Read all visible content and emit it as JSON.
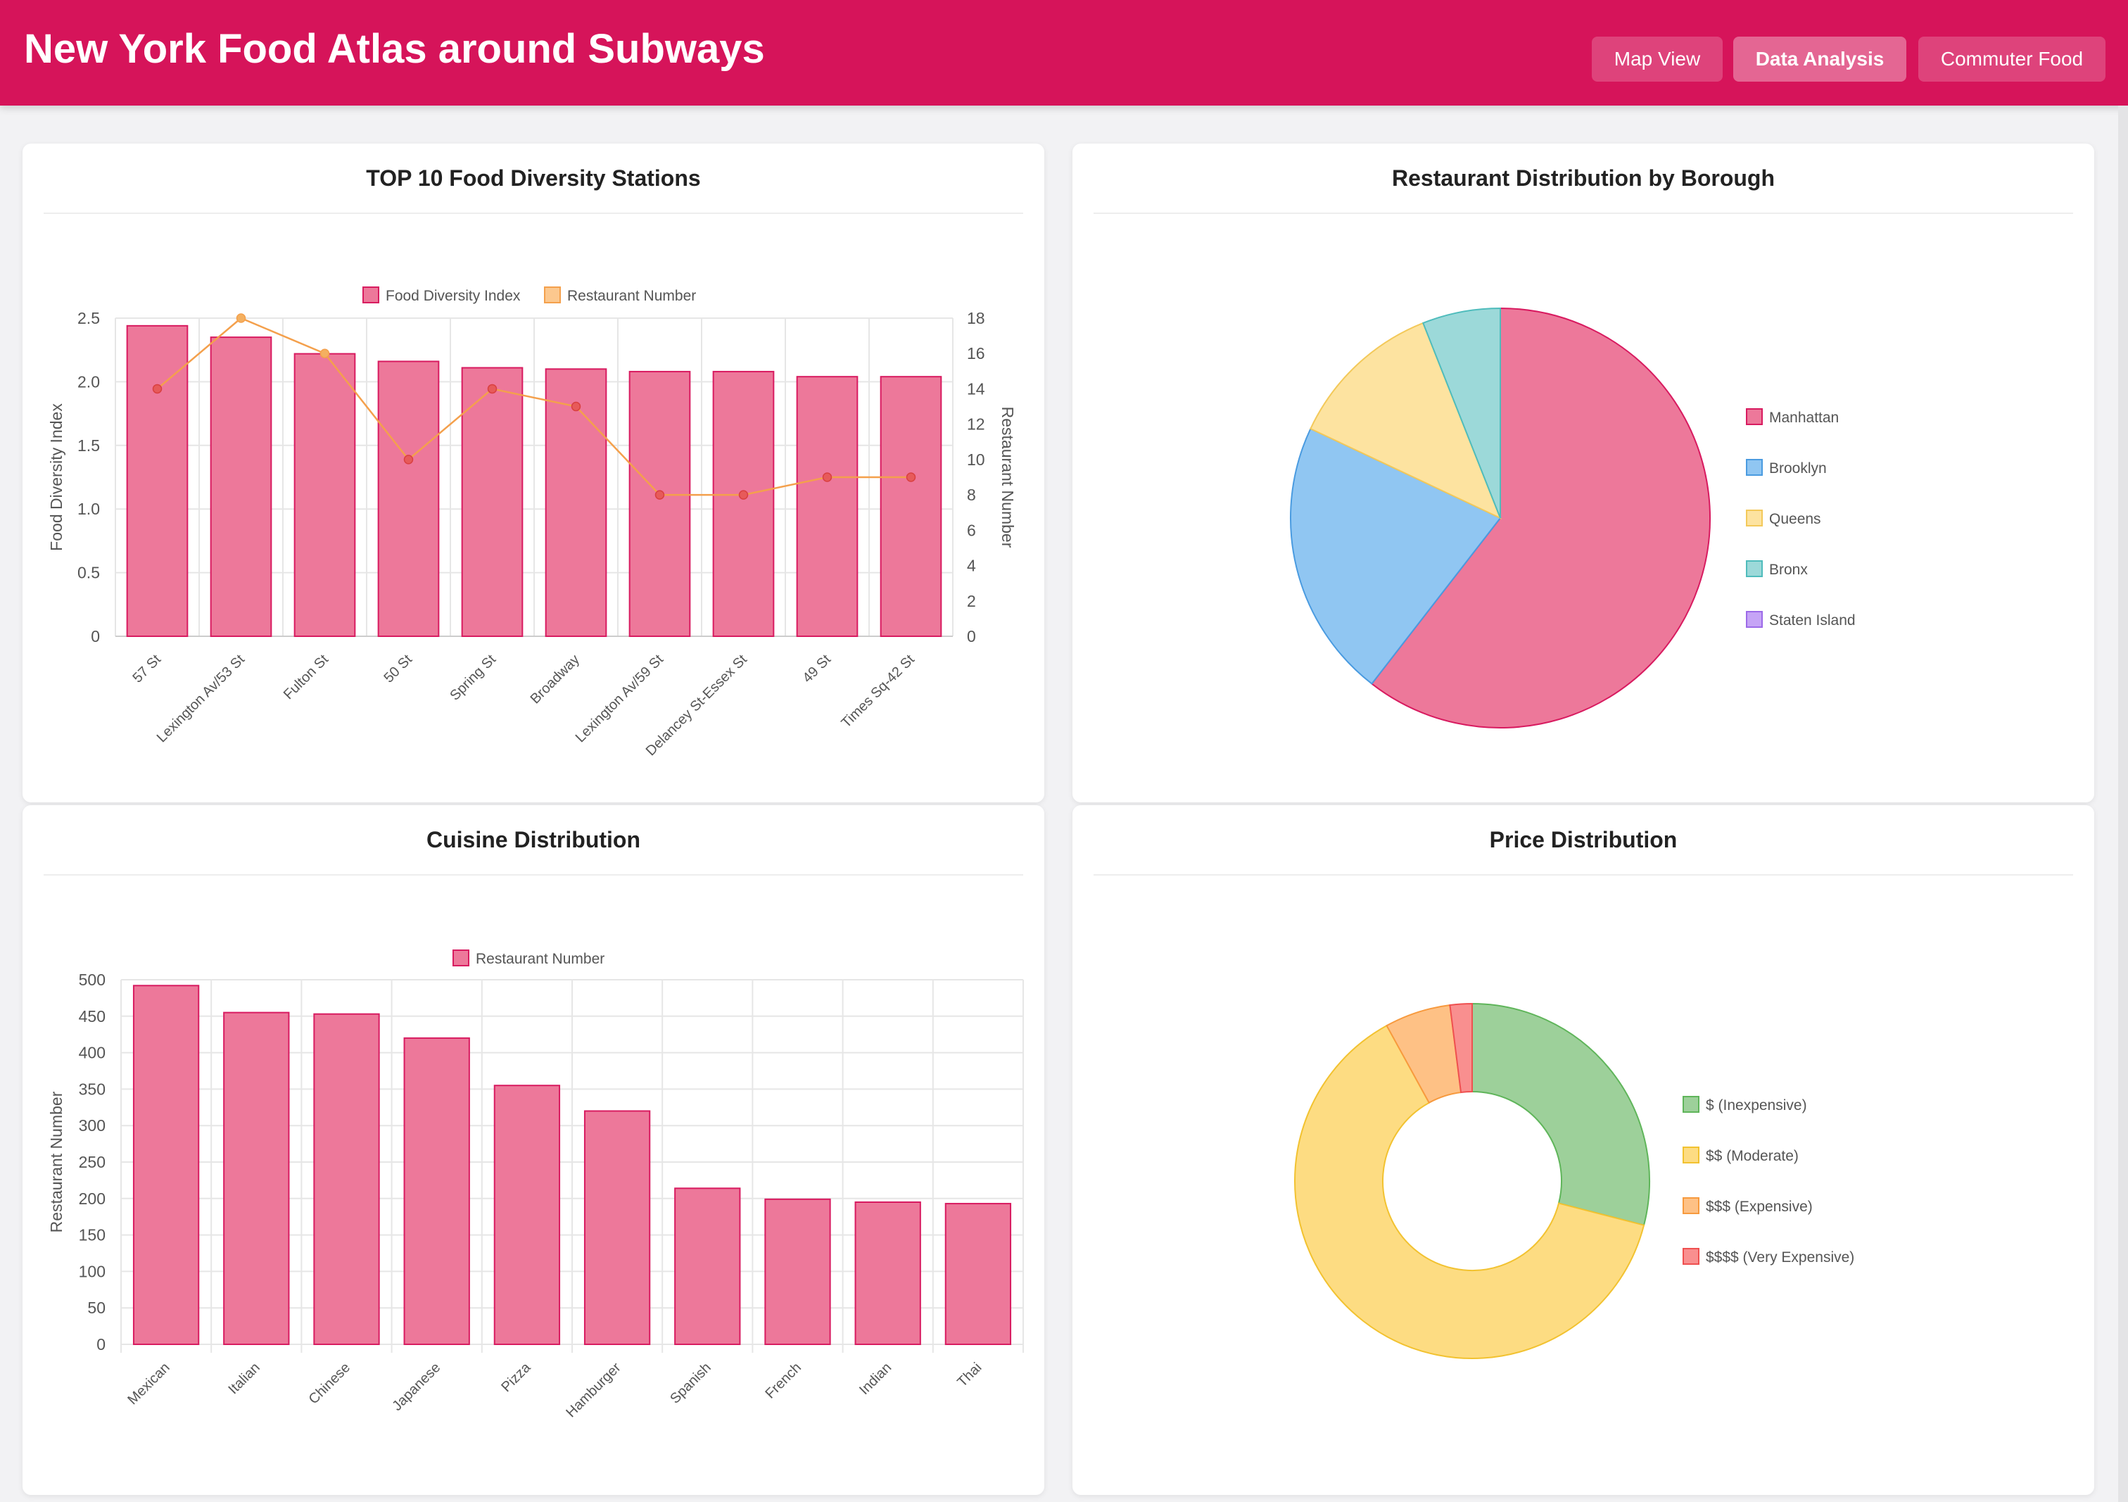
{
  "header": {
    "title": "New York Food Atlas around Subways",
    "nav": [
      "Map View",
      "Data Analysis",
      "Commuter Food"
    ],
    "active_nav": "Data Analysis"
  },
  "colors": {
    "brand": "#d6145a",
    "bar_fill": "#ed789a",
    "bar_stroke": "#d81b60",
    "line": "#f4a04c",
    "point": "#e75a5a"
  },
  "cards": {
    "diversity_title": "TOP 10 Food Diversity Stations",
    "borough_title": "Restaurant Distribution by Borough",
    "cuisine_title": "Cuisine Distribution",
    "price_title": "Price Distribution"
  },
  "chart_data": [
    {
      "type": "bar",
      "title": "TOP 10 Food Diversity Stations",
      "categories": [
        "57 St",
        "Lexington Av/53 St",
        "Fulton St",
        "50 St",
        "Spring St",
        "Broadway",
        "Lexington Av/59 St",
        "Delancey St-Essex St",
        "49 St",
        "Times Sq-42 St"
      ],
      "series": [
        {
          "name": "Food Diversity Index",
          "type": "bar",
          "axis": "left",
          "values": [
            2.44,
            2.35,
            2.22,
            2.16,
            2.11,
            2.1,
            2.08,
            2.08,
            2.04,
            2.04
          ]
        },
        {
          "name": "Restaurant Number",
          "type": "line",
          "axis": "right",
          "values": [
            14,
            18,
            16,
            10,
            14,
            13,
            8,
            8,
            9,
            9
          ]
        }
      ],
      "ylabel": "Food Diversity Index",
      "y2label": "Restaurant Number",
      "ylim": [
        0,
        2.5
      ],
      "y2lim": [
        0,
        18
      ],
      "yticks": [
        "0",
        "0.5",
        "1.0",
        "1.5",
        "2.0",
        "2.5"
      ],
      "y2ticks": [
        "0",
        "2",
        "4",
        "6",
        "8",
        "10",
        "12",
        "14",
        "16",
        "18"
      ],
      "grid": true,
      "legend": "top-center"
    },
    {
      "type": "pie",
      "title": "Restaurant Distribution by Borough",
      "categories": [
        "Manhattan",
        "Brooklyn",
        "Queens",
        "Bronx",
        "Staten Island"
      ],
      "values": [
        60.5,
        21.5,
        12,
        6,
        0
      ],
      "colors": [
        "#ed789a",
        "#90c6f2",
        "#fde3a0",
        "#9cd9d9",
        "#c6a4f6"
      ],
      "stroke_colors": [
        "#d81b60",
        "#4a9be0",
        "#f3c95a",
        "#4fbcbc",
        "#9c6ae8"
      ],
      "legend": "right"
    },
    {
      "type": "bar",
      "title": "Cuisine Distribution",
      "categories": [
        "Mexican",
        "Italian",
        "Chinese",
        "Japanese",
        "Pizza",
        "Hamburger",
        "Spanish",
        "French",
        "Indian",
        "Thai"
      ],
      "series": [
        {
          "name": "Restaurant Number",
          "values": [
            492,
            455,
            453,
            420,
            355,
            320,
            214,
            199,
            195,
            193
          ]
        }
      ],
      "ylabel": "Restaurant Number",
      "ylim": [
        0,
        500
      ],
      "yticks": [
        "0",
        "50",
        "100",
        "150",
        "200",
        "250",
        "300",
        "350",
        "400",
        "450",
        "500"
      ],
      "grid": true,
      "legend": "top-center"
    },
    {
      "type": "pie",
      "title": "Price Distribution",
      "categories": [
        "$ (Inexpensive)",
        "$$ (Moderate)",
        "$$$ (Expensive)",
        "$$$$ (Very Expensive)"
      ],
      "values": [
        29,
        63,
        6,
        2
      ],
      "colors": [
        "#9dd09a",
        "#fddc82",
        "#fec185",
        "#f98f8f"
      ],
      "stroke_colors": [
        "#5fb55a",
        "#f2c230",
        "#f79a3e",
        "#ef5050"
      ],
      "donut": true,
      "legend": "right"
    }
  ]
}
